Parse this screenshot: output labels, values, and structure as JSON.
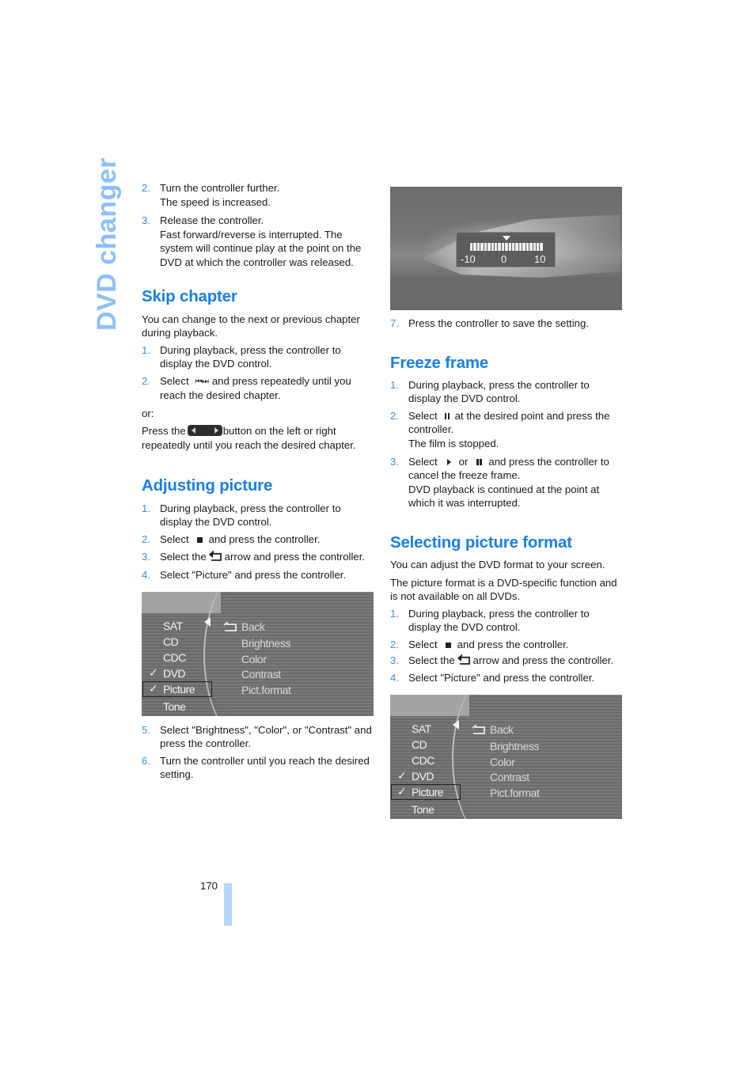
{
  "page": {
    "side_title": "DVD changer",
    "page_number": "170",
    "accent_color": "#1a7ee6",
    "side_title_color": "#8ec0f6",
    "page_bar_color": "#b6d6fb"
  },
  "left": {
    "continued_steps": [
      {
        "num": "2.",
        "lines": [
          "Turn the controller further.",
          "The speed is increased."
        ]
      },
      {
        "num": "3.",
        "lines": [
          "Release the controller.",
          "Fast forward/reverse is interrupted. The system will continue play at the point on the DVD at which the controller was released."
        ]
      }
    ],
    "skip_chapter": {
      "heading": "Skip chapter",
      "intro": "You can change to the next or previous chapter during playback.",
      "step1": {
        "num": "1.",
        "text": "During playback, press the controller to display the DVD control."
      },
      "step2": {
        "num": "2.",
        "before": "Select",
        "icon": "skip-prev-next-icon",
        "after": "and press repeatedly until you reach the desired chapter."
      },
      "or": "or:",
      "press_before": "Press the",
      "press_icon": "rocker-button-icon",
      "press_after": "button on the left or right repeatedly until you reach the desired chapter."
    },
    "adjusting_picture": {
      "heading": "Adjusting picture",
      "step1": {
        "num": "1.",
        "text": "During playback, press the controller to display the DVD control."
      },
      "step2": {
        "num": "2.",
        "before": "Select",
        "icon": "stop-square-icon",
        "after": "and press the controller."
      },
      "step3": {
        "num": "3.",
        "before": "Select the",
        "icon": "back-arrow-icon",
        "after": "arrow and press the controller."
      },
      "step4": {
        "num": "4.",
        "text": "Select \"Picture\" and press the controller."
      },
      "step5": {
        "num": "5.",
        "text": "Select \"Brightness\", \"Color\", or \"Contrast\" and press the controller."
      },
      "step6": {
        "num": "6.",
        "text": "Turn the controller until you reach the desired setting."
      }
    },
    "menu_screen": {
      "left_items": [
        "SAT",
        "CD",
        "CDC",
        "DVD",
        "Picture",
        "Tone"
      ],
      "checked_items": [
        "DVD",
        "Picture"
      ],
      "highlighted_item": "Picture",
      "right_items": [
        "Back",
        "Brightness",
        "Color",
        "Contrast",
        "Pict.format"
      ]
    }
  },
  "right": {
    "brightness_screen": {
      "scale_min": "-10",
      "scale_mid": "0",
      "scale_max": "10",
      "current_value": 0
    },
    "step7": {
      "num": "7.",
      "text": "Press the controller to save the setting."
    },
    "freeze_frame": {
      "heading": "Freeze frame",
      "step1": {
        "num": "1.",
        "text": "During playback, press the controller to display the DVD control."
      },
      "step2": {
        "num": "2.",
        "before": "Select",
        "icon": "pause-icon",
        "after": "at the desired point and press the controller.",
        "note": "The film is stopped."
      },
      "step3": {
        "num": "3.",
        "before": "Select",
        "icon1": "play-icon",
        "or": "or",
        "icon2": "pause-icon",
        "after": "and press the controller to cancel the freeze frame.",
        "note": "DVD playback is continued at the point at which it was interrupted."
      }
    },
    "picture_format": {
      "heading": "Selecting picture format",
      "intro1": "You can adjust the DVD format to your screen.",
      "intro2": "The picture format is a DVD-specific function and is not available on all DVDs.",
      "step1": {
        "num": "1.",
        "text": "During playback, press the controller to display the DVD control."
      },
      "step2": {
        "num": "2.",
        "before": "Select",
        "icon": "stop-square-icon",
        "after": "and press the controller."
      },
      "step3": {
        "num": "3.",
        "before": "Select the",
        "icon": "back-arrow-icon",
        "after": "arrow and press the controller."
      },
      "step4": {
        "num": "4.",
        "text": "Select \"Picture\" and press the controller."
      }
    },
    "menu_screen": {
      "left_items": [
        "SAT",
        "CD",
        "CDC",
        "DVD",
        "Picture",
        "Tone"
      ],
      "checked_items": [
        "DVD",
        "Picture"
      ],
      "highlighted_item": "Picture",
      "right_items": [
        "Back",
        "Brightness",
        "Color",
        "Contrast",
        "Pict.format"
      ]
    }
  }
}
